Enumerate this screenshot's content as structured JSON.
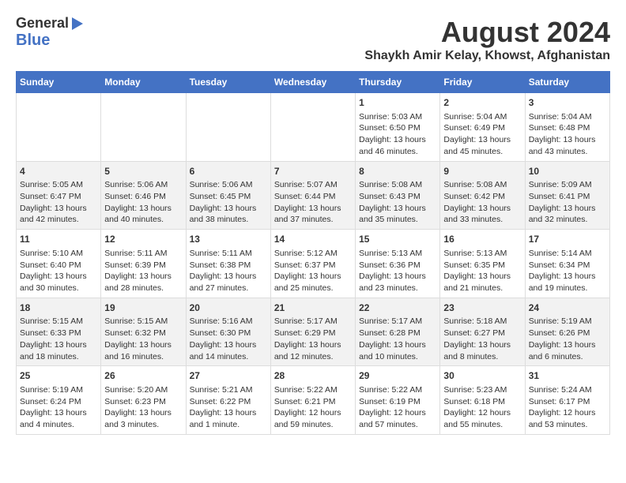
{
  "header": {
    "logo_line1": "General",
    "logo_line2": "Blue",
    "main_title": "August 2024",
    "subtitle": "Shaykh Amir Kelay, Khowst, Afghanistan"
  },
  "weekdays": [
    "Sunday",
    "Monday",
    "Tuesday",
    "Wednesday",
    "Thursday",
    "Friday",
    "Saturday"
  ],
  "weeks": [
    [
      {
        "num": "",
        "info": ""
      },
      {
        "num": "",
        "info": ""
      },
      {
        "num": "",
        "info": ""
      },
      {
        "num": "",
        "info": ""
      },
      {
        "num": "1",
        "info": "Sunrise: 5:03 AM\nSunset: 6:50 PM\nDaylight: 13 hours\nand 46 minutes."
      },
      {
        "num": "2",
        "info": "Sunrise: 5:04 AM\nSunset: 6:49 PM\nDaylight: 13 hours\nand 45 minutes."
      },
      {
        "num": "3",
        "info": "Sunrise: 5:04 AM\nSunset: 6:48 PM\nDaylight: 13 hours\nand 43 minutes."
      }
    ],
    [
      {
        "num": "4",
        "info": "Sunrise: 5:05 AM\nSunset: 6:47 PM\nDaylight: 13 hours\nand 42 minutes."
      },
      {
        "num": "5",
        "info": "Sunrise: 5:06 AM\nSunset: 6:46 PM\nDaylight: 13 hours\nand 40 minutes."
      },
      {
        "num": "6",
        "info": "Sunrise: 5:06 AM\nSunset: 6:45 PM\nDaylight: 13 hours\nand 38 minutes."
      },
      {
        "num": "7",
        "info": "Sunrise: 5:07 AM\nSunset: 6:44 PM\nDaylight: 13 hours\nand 37 minutes."
      },
      {
        "num": "8",
        "info": "Sunrise: 5:08 AM\nSunset: 6:43 PM\nDaylight: 13 hours\nand 35 minutes."
      },
      {
        "num": "9",
        "info": "Sunrise: 5:08 AM\nSunset: 6:42 PM\nDaylight: 13 hours\nand 33 minutes."
      },
      {
        "num": "10",
        "info": "Sunrise: 5:09 AM\nSunset: 6:41 PM\nDaylight: 13 hours\nand 32 minutes."
      }
    ],
    [
      {
        "num": "11",
        "info": "Sunrise: 5:10 AM\nSunset: 6:40 PM\nDaylight: 13 hours\nand 30 minutes."
      },
      {
        "num": "12",
        "info": "Sunrise: 5:11 AM\nSunset: 6:39 PM\nDaylight: 13 hours\nand 28 minutes."
      },
      {
        "num": "13",
        "info": "Sunrise: 5:11 AM\nSunset: 6:38 PM\nDaylight: 13 hours\nand 27 minutes."
      },
      {
        "num": "14",
        "info": "Sunrise: 5:12 AM\nSunset: 6:37 PM\nDaylight: 13 hours\nand 25 minutes."
      },
      {
        "num": "15",
        "info": "Sunrise: 5:13 AM\nSunset: 6:36 PM\nDaylight: 13 hours\nand 23 minutes."
      },
      {
        "num": "16",
        "info": "Sunrise: 5:13 AM\nSunset: 6:35 PM\nDaylight: 13 hours\nand 21 minutes."
      },
      {
        "num": "17",
        "info": "Sunrise: 5:14 AM\nSunset: 6:34 PM\nDaylight: 13 hours\nand 19 minutes."
      }
    ],
    [
      {
        "num": "18",
        "info": "Sunrise: 5:15 AM\nSunset: 6:33 PM\nDaylight: 13 hours\nand 18 minutes."
      },
      {
        "num": "19",
        "info": "Sunrise: 5:15 AM\nSunset: 6:32 PM\nDaylight: 13 hours\nand 16 minutes."
      },
      {
        "num": "20",
        "info": "Sunrise: 5:16 AM\nSunset: 6:30 PM\nDaylight: 13 hours\nand 14 minutes."
      },
      {
        "num": "21",
        "info": "Sunrise: 5:17 AM\nSunset: 6:29 PM\nDaylight: 13 hours\nand 12 minutes."
      },
      {
        "num": "22",
        "info": "Sunrise: 5:17 AM\nSunset: 6:28 PM\nDaylight: 13 hours\nand 10 minutes."
      },
      {
        "num": "23",
        "info": "Sunrise: 5:18 AM\nSunset: 6:27 PM\nDaylight: 13 hours\nand 8 minutes."
      },
      {
        "num": "24",
        "info": "Sunrise: 5:19 AM\nSunset: 6:26 PM\nDaylight: 13 hours\nand 6 minutes."
      }
    ],
    [
      {
        "num": "25",
        "info": "Sunrise: 5:19 AM\nSunset: 6:24 PM\nDaylight: 13 hours\nand 4 minutes."
      },
      {
        "num": "26",
        "info": "Sunrise: 5:20 AM\nSunset: 6:23 PM\nDaylight: 13 hours\nand 3 minutes."
      },
      {
        "num": "27",
        "info": "Sunrise: 5:21 AM\nSunset: 6:22 PM\nDaylight: 13 hours\nand 1 minute."
      },
      {
        "num": "28",
        "info": "Sunrise: 5:22 AM\nSunset: 6:21 PM\nDaylight: 12 hours\nand 59 minutes."
      },
      {
        "num": "29",
        "info": "Sunrise: 5:22 AM\nSunset: 6:19 PM\nDaylight: 12 hours\nand 57 minutes."
      },
      {
        "num": "30",
        "info": "Sunrise: 5:23 AM\nSunset: 6:18 PM\nDaylight: 12 hours\nand 55 minutes."
      },
      {
        "num": "31",
        "info": "Sunrise: 5:24 AM\nSunset: 6:17 PM\nDaylight: 12 hours\nand 53 minutes."
      }
    ]
  ]
}
